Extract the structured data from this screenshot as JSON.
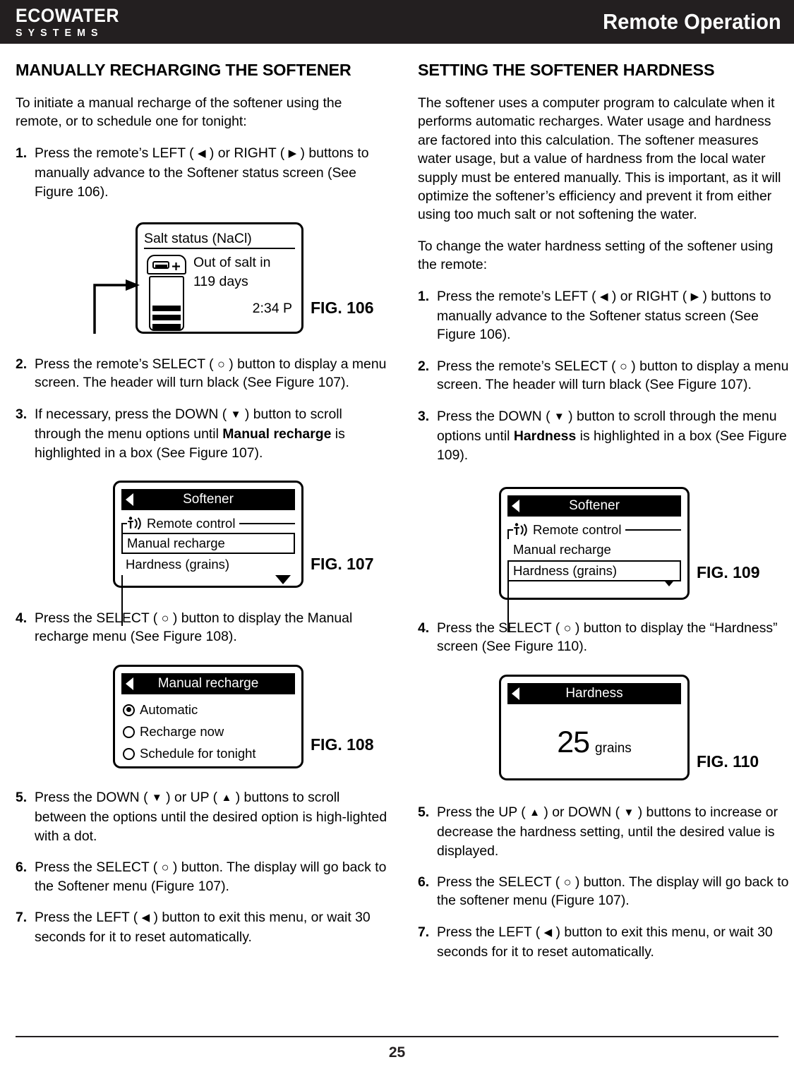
{
  "header": {
    "logo_main": "ECOWATER",
    "logo_sub": "SYSTEMS",
    "title": "Remote Operation"
  },
  "left_column": {
    "section_title": "MANUALLY RECHARGING THE SOFTENER",
    "intro": "To initiate a manual recharge of the softener using the remote, or to schedule one for tonight:",
    "steps": [
      {
        "num": "1.",
        "text_1": "Press the remote’s LEFT ( ",
        "icon_a": "left-triangle-icon",
        "text_2": " ) or RIGHT ( ",
        "icon_b": "right-triangle-icon",
        "text_3": " ) buttons to manually advance to the Softener status screen (See Figure 106)."
      },
      {
        "num": "2.",
        "text_1": "Press the remote’s SELECT ( ",
        "icon_a": "circle-icon",
        "text_2": " ) button to display a menu screen.  The header will turn black (See Figure 107)."
      },
      {
        "num": "3.",
        "text_1": "If necessary, press the DOWN ( ",
        "icon_a": "down-triangle-icon",
        "text_2": " ) button to scroll through the menu options until ",
        "bold": "Manual recharge",
        "text_3": " is highlighted in a box (See Figure 107)."
      },
      {
        "num": "4.",
        "text_1": "Press the SELECT ( ",
        "icon_a": "circle-icon",
        "text_2": " ) button to display the Manual recharge menu (See Figure 108)."
      },
      {
        "num": "5.",
        "text_1": "Press the DOWN ( ",
        "icon_a": "down-triangle-icon",
        "text_2": " ) or UP ( ",
        "icon_b": "up-triangle-icon",
        "text_3": " ) buttons to scroll between the options until the desired option is high-lighted with a dot."
      },
      {
        "num": "6.",
        "text_1": "Press the SELECT ( ",
        "icon_a": "circle-icon",
        "text_2": " ) button.  The display will go back to the Softener menu (Figure 107)."
      },
      {
        "num": "7.",
        "text_1": "Press the LEFT ( ",
        "icon_a": "left-triangle-icon",
        "text_2": " ) button to exit this menu, or wait 30 seconds for it to reset automatically."
      }
    ]
  },
  "right_column": {
    "section_title": "SETTING THE SOFTENER HARDNESS",
    "intro_1": "The softener uses a computer program to calculate when it performs automatic recharges.  Water usage and hardness are factored into this calculation.  The softener measures water usage, but a value of hardness from the local water supply must be entered manually.  This is important, as it will optimize the softener’s efficiency and prevent it from either using too much salt or not softening the water.",
    "intro_2": "To change the water hardness setting of the softener using the remote:",
    "steps": [
      {
        "num": "1.",
        "text_1": "Press the remote’s LEFT ( ",
        "icon_a": "left-triangle-icon",
        "text_2": " ) or RIGHT ( ",
        "icon_b": "right-triangle-icon",
        "text_3": " ) buttons to manually advance to the Softener status screen (See Figure 106)."
      },
      {
        "num": "2.",
        "text_1": "Press the remote’s SELECT ( ",
        "icon_a": "circle-icon",
        "text_2": " ) button to display a menu screen.  The header will turn black (See Figure 107)."
      },
      {
        "num": "3.",
        "text_1": "Press the DOWN ( ",
        "icon_a": "down-triangle-icon",
        "text_2": " ) button to scroll through the menu options until ",
        "bold": "Hardness",
        "text_3": " is highlighted in a box (See Figure 109)."
      },
      {
        "num": "4.",
        "text_1": "Press the SELECT ( ",
        "icon_a": "circle-icon",
        "text_2": " ) button to display the “Hardness” screen (See Figure 110)."
      },
      {
        "num": "5.",
        "text_1": "Press the UP ( ",
        "icon_a": "up-triangle-icon",
        "text_2": " ) or DOWN ( ",
        "icon_b": "down-triangle-icon",
        "text_3": " ) buttons to increase or decrease the hardness setting, until the desired value is displayed."
      },
      {
        "num": "6.",
        "text_1": "Press the SELECT ( ",
        "icon_a": "circle-icon",
        "text_2": " ) button.  The display will go back to the softener menu (Figure 107)."
      },
      {
        "num": "7.",
        "text_1": "Press the LEFT ( ",
        "icon_a": "left-triangle-icon",
        "text_2": " ) button to exit this menu, or wait 30 seconds for it to reset automatically."
      }
    ]
  },
  "figures": {
    "fig106": {
      "label": "FIG. 106",
      "screen_header": "Salt status (NaCl)",
      "status_line_1": "Out of salt in",
      "status_line_2": "119 days",
      "time": "2:34 P"
    },
    "fig107": {
      "label": "FIG. 107",
      "title": "Softener",
      "group_label": "Remote control",
      "item_1": "Manual recharge",
      "item_2": "Hardness (grains)",
      "highlighted": "Manual recharge"
    },
    "fig108": {
      "label": "FIG. 108",
      "title": "Manual recharge",
      "options": [
        {
          "label": "Automatic",
          "selected": true
        },
        {
          "label": "Recharge now",
          "selected": false
        },
        {
          "label": "Schedule for tonight",
          "selected": false
        }
      ]
    },
    "fig109": {
      "label": "FIG. 109",
      "title": "Softener",
      "group_label": "Remote control",
      "item_1": "Manual recharge",
      "item_2": "Hardness (grains)",
      "highlighted": "Hardness (grains)"
    },
    "fig110": {
      "label": "FIG. 110",
      "title": "Hardness",
      "value": "25",
      "unit": "grains"
    }
  },
  "footer": {
    "page_number": "25"
  }
}
